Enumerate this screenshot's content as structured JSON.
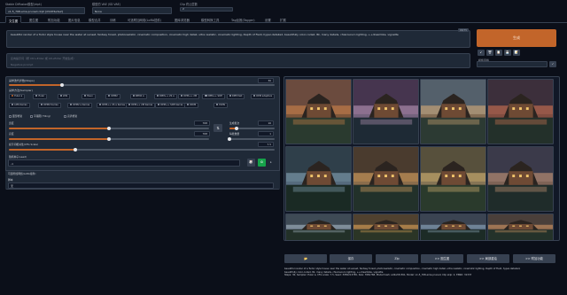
{
  "top": {
    "model_label": "Stable Diffusion模型(ckpt)",
    "model_value": "v1-5_768-ema-pruned.ckpt [d3c0f4e3e2]",
    "vae_label": "模型的 VAE (SD VAE)",
    "vae_value": "None",
    "clip_label": "Clip 终止层数",
    "clip_value": "2"
  },
  "tabs": [
    "文生图",
    "图生图",
    "附加功能",
    "图片信息",
    "模型合并",
    "训练",
    "可选附加网络(LoRA插件)",
    "图库浏览器",
    "模型转换工具",
    "Tag反推(Tagger)",
    "设置",
    "扩展"
  ],
  "prompt": {
    "text": "beautiful render of a Tudor style house near the water at sunset, fantasy forest, photorealistic, cinematic composition, cinematic high detail, ultra realistic, cinematic lighting, Depth of Field, hyper-detailed, beautifully color-coded, 8k, many details, chiaroscuro lighting, ++dreamlike, vignette",
    "token_count": "68/75",
    "negative_placeholder": "反向提示词（按 Ctrl+Enter 或 Alt+Enter 开始生成）",
    "negative_sub": "Negative prompt"
  },
  "generate_label": "生成",
  "tool_buttons": [
    "↙",
    "🗑",
    "📋",
    "💾",
    "📝"
  ],
  "style": {
    "label": "模板风格",
    "apply": "✓"
  },
  "settings": {
    "steps_label": "采样迭代步数(Steps)",
    "steps_value": "30",
    "steps_frac": 0.2,
    "sampler_label": "采样方法(Sampler)",
    "samplers_row1": [
      "Euler a",
      "Euler",
      "LMS",
      "Heun",
      "DPM2",
      "DPM2 a",
      "DPM++ 2S a",
      "DPM++ 2M",
      "DPM++ SDE",
      "DPM fast",
      "DPM adaptive"
    ],
    "samplers_row2": [
      "LMS Karras",
      "DPM2 Karras",
      "DPM2 a Karras",
      "DPM++ 2S a Karras",
      "DPM++ 2M Karras",
      "DPM++ SDE Karras",
      "DDIM",
      "PLMS"
    ],
    "checkbox_labels": [
      "面部修复",
      "平铺图 (Tiling)",
      "高清修复"
    ],
    "width_label": "宽度",
    "width_value": "768",
    "width_frac": 0.5,
    "height_label": "高度",
    "height_value": "768",
    "height_frac": 0.5,
    "swap_icon": "⇅",
    "batch_count_label": "生成批次",
    "batch_count_value": "16",
    "batch_count_frac": 0.15,
    "batch_size_label": "每批数量",
    "batch_size_value": "1",
    "batch_size_frac": 0.0,
    "cfg_label": "提示词相关性(CFG Scale)",
    "cfg_value": "7.5",
    "cfg_frac": 0.25,
    "seed_label": "随机种子(seed)",
    "seed_value": "-1",
    "dice_icon": "🎲",
    "recycle_icon": "♻",
    "extra_caret": "▸"
  },
  "scripts": {
    "label": "可选附加网络(LoRA插件)",
    "script_label": "脚本",
    "script_value": "无"
  },
  "actions": [
    "📂",
    "保存",
    "Zip",
    ">> 图生图",
    ">> 局部重绘",
    ">> 附加功能"
  ],
  "info": {
    "line1": "beautiful render of a Tudor style house near the water at sunset, fantasy forest, photorealistic, cinematic composition, cinematic high detail, ultra realistic, cinematic lighting, Depth of Field, hyper-detailed,",
    "line2": "beautifully color-coded, 8k, many details, chiaroscuro lighting, ++dreamlike, vignette",
    "line3": "Steps: 30, Sampler: Euler a, CFG scale: 7.5, Seed: 3950213765, Size: 768x768, Model hash: ad2a33c361, Model: v1-5_768-ema-pruned, Clip skip: 2, ENSD: 31337"
  }
}
